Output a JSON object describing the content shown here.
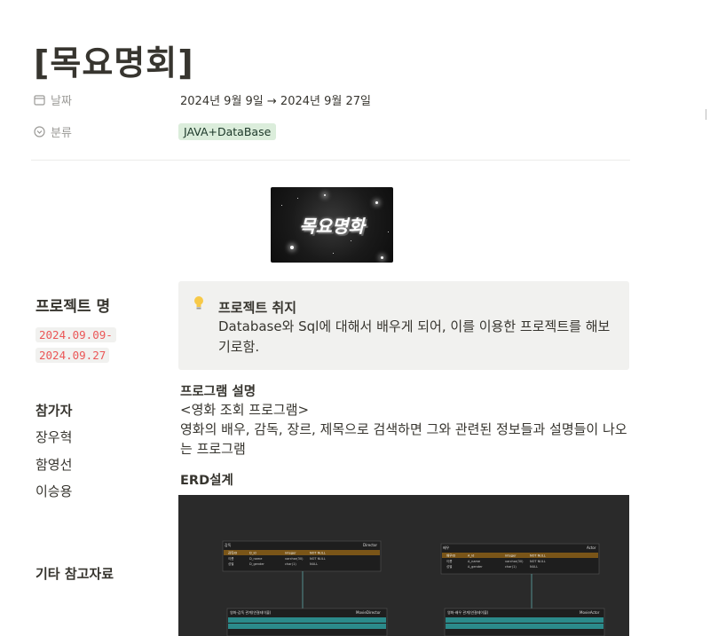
{
  "page": {
    "title": "[목요명회]"
  },
  "properties": [
    {
      "icon": "calendar-icon",
      "label": "날짜",
      "value": "2024년 9월 9일 → 2024년 9월 27일"
    },
    {
      "icon": "select-icon",
      "label": "분류",
      "tag": "JAVA+DataBase"
    }
  ],
  "cover": {
    "logo_text": "목요명화"
  },
  "sidebar": {
    "project_heading": "프로젝트 명",
    "date_start": "2024.09.09-",
    "date_end": "2024.09.27",
    "members_heading": "참가자",
    "members": [
      "장우혁",
      "함영선",
      "이승용"
    ],
    "references_heading": "기타 참고자료"
  },
  "callout": {
    "icon": "lightbulb-icon",
    "title": "프로젝트 취지",
    "body": "Database와 Sql에 대해서 배우게 되어, 이를 이용한 프로젝트를 해보기로함."
  },
  "program": {
    "heading": "프로그램 설명",
    "subtitle": "<영화 조회 프로그램>",
    "description": "영화의 배우, 감독, 장르, 제목으로 검색하면 그와 관련된 정보들과 설명들이 나오는 프로그램"
  },
  "erd": {
    "heading": "ERD설계",
    "tables": [
      {
        "title": "감독",
        "name": "Director",
        "rows": [
          [
            "감독ID",
            "D_id",
            "integer",
            "NOT NULL"
          ],
          [
            "이름",
            "D_name",
            "varchar(30)",
            "NOT NULL"
          ],
          [
            "성별",
            "D_gender",
            "char(1)",
            "NULL"
          ]
        ]
      },
      {
        "title": "배우",
        "name": "Actor",
        "rows": [
          [
            "배우ID",
            "A_id",
            "integer",
            "NOT NULL"
          ],
          [
            "이름",
            "A_name",
            "varchar(30)",
            "NOT NULL"
          ],
          [
            "성별",
            "A_gender",
            "char(1)",
            "NULL"
          ]
        ]
      },
      {
        "title": "영화-감독 관계(연결테이블)",
        "name": "MovieDirector"
      },
      {
        "title": "영화-배우 관계(연결테이블)",
        "name": "MovieActor"
      }
    ]
  },
  "colors": {
    "tag_bg": "#dbeddb",
    "code_text": "#eb5757",
    "callout_bg": "#f1f1ef",
    "erd_bg": "#2a2a2a",
    "erd_link": "#2b8a8a"
  }
}
